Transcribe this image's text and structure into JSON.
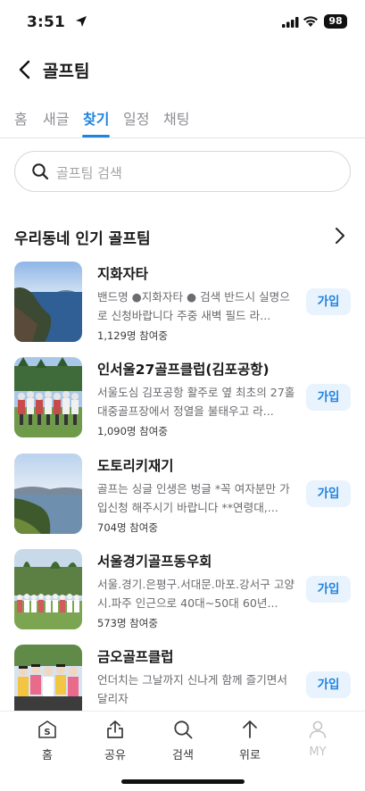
{
  "status_bar": {
    "time": "3:51",
    "battery": "98"
  },
  "header": {
    "title": "골프팀"
  },
  "tabs": [
    {
      "label": "홈"
    },
    {
      "label": "새글"
    },
    {
      "label": "찾기",
      "active": true
    },
    {
      "label": "일정"
    },
    {
      "label": "채팅"
    }
  ],
  "search": {
    "placeholder": "골프팀 검색"
  },
  "section": {
    "title": "우리동네 인기 골프팀"
  },
  "clubs": [
    {
      "name": "지화자타",
      "desc": "밴드명 ●지화자타 ● 검색 반드시 실명으로 신청바랍니다 주중 새벽 필드 라...",
      "count": "1,129명 참여중",
      "join": "가입"
    },
    {
      "name": "인서울27골프클럽(김포공항)",
      "desc": "서울도심 김포공항 활주로 옆 최초의 27홀 대중골프장에서 정열을 불태우고 라...",
      "count": "1,090명 참여중",
      "join": "가입"
    },
    {
      "name": "도토리키재기",
      "desc": "골프는 싱글 인생은 벙글 *꼭 여자분만 가입신청 해주시기 바랍니다 **연령대,...",
      "count": "704명 참여중",
      "join": "가입"
    },
    {
      "name": "서울경기골프동우회",
      "desc": "서울.경기.은평구.서대문.마포.강서구 고양시.파주 인근으로 40대~50대 60년...",
      "count": "573명 참여중",
      "join": "가입"
    },
    {
      "name": "금오골프클럽",
      "desc": "언더치는 그날까지 신나게 함께 즐기면서 달리자",
      "count": "",
      "join": "가입"
    }
  ],
  "bottom_nav": [
    {
      "label": "홈",
      "icon": "home-s-icon"
    },
    {
      "label": "공유",
      "icon": "share-icon"
    },
    {
      "label": "검색",
      "icon": "search-icon"
    },
    {
      "label": "위로",
      "icon": "arrow-up-icon"
    },
    {
      "label": "MY",
      "icon": "person-icon",
      "disabled": true
    }
  ],
  "colors": {
    "accent": "#1f84e0",
    "join_bg": "#e9f3fe",
    "muted": "#8e8e93"
  }
}
